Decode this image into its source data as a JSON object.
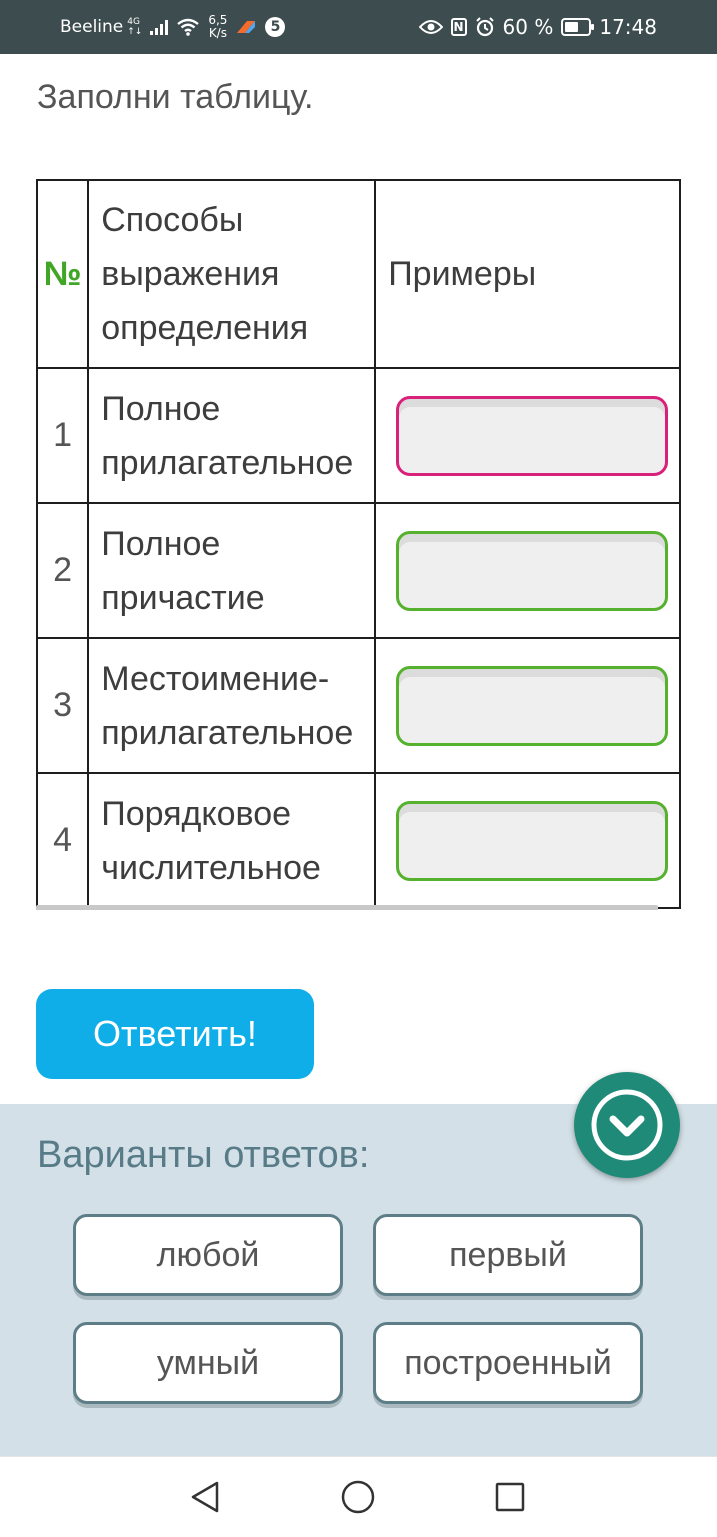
{
  "status_bar": {
    "carrier": "Beeline",
    "network": "4G",
    "network_sub": "↑↓",
    "speed_value": "6,5",
    "speed_unit": "K/s",
    "app_badge": "5",
    "nfc": "N",
    "battery": "60 %",
    "battery_level": 0.6,
    "time": "17:48"
  },
  "instruction": "Заполни таблицу.",
  "table": {
    "headers": {
      "num": "№",
      "way": "Способы выражения определения",
      "examples": "Примеры"
    },
    "rows": [
      {
        "num": "1",
        "way": "Полное прилагательное",
        "answer": "",
        "state": "active"
      },
      {
        "num": "2",
        "way": "Полное причастие",
        "answer": "",
        "state": "empty"
      },
      {
        "num": "3",
        "way": "Местоимение-прилагательное",
        "answer": "",
        "state": "empty"
      },
      {
        "num": "4",
        "way": "Порядковое числительное",
        "answer": "",
        "state": "empty"
      }
    ]
  },
  "submit_label": "Ответить!",
  "options": {
    "title": "Варианты ответов:",
    "items": [
      "любой",
      "первый",
      "умный",
      "построенный"
    ]
  },
  "colors": {
    "accent_button": "#0faee8",
    "active_border": "#d8217a",
    "empty_border": "#55b12e",
    "num_header": "#3fa626",
    "panel_bg": "#d3e0e7",
    "fab": "#1f8a78"
  },
  "icons": {
    "collapse": "chevron-down-circle-icon",
    "nav_back": "triangle-back-icon",
    "nav_home": "circle-home-icon",
    "nav_recent": "square-recent-icon"
  }
}
